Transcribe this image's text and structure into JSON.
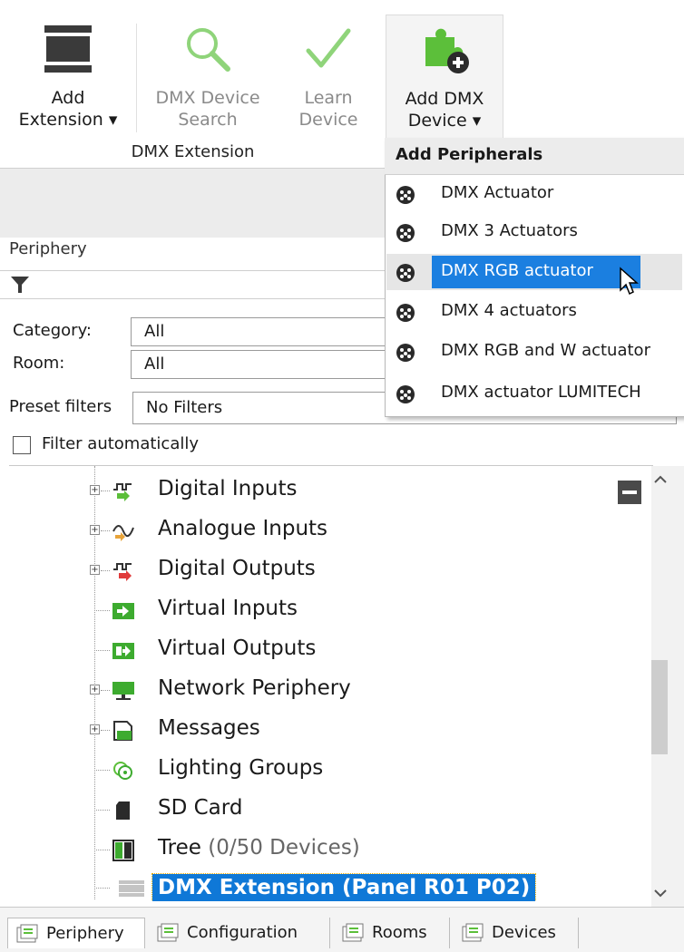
{
  "ribbon": {
    "buttons": [
      {
        "label_line1": "Add",
        "label_line2": "Extension ▾",
        "enabled": true
      },
      {
        "label_line1": "DMX Device",
        "label_line2": "Search",
        "enabled": false
      },
      {
        "label_line1": "Learn",
        "label_line2": "Device",
        "enabled": false
      },
      {
        "label_line1": "Add DMX",
        "label_line2": "Device ▾",
        "enabled": true
      }
    ],
    "group_label": "DMX Extension"
  },
  "panel": {
    "title": "Periphery"
  },
  "filters": {
    "category_label": "Category:",
    "category_value": "All",
    "room_label": "Room:",
    "room_value": "All",
    "preset_label": "Preset filters",
    "preset_value": "No Filters",
    "auto_label": "Filter automatically",
    "auto_checked": false
  },
  "tree": {
    "items": [
      {
        "label": "Digital Inputs",
        "icon": "digital-inputs-icon",
        "expandable": true
      },
      {
        "label": "Analogue Inputs",
        "icon": "analogue-inputs-icon",
        "expandable": true
      },
      {
        "label": "Digital Outputs",
        "icon": "digital-outputs-icon",
        "expandable": true
      },
      {
        "label": "Virtual Inputs",
        "icon": "virtual-inputs-icon",
        "expandable": false
      },
      {
        "label": "Virtual Outputs",
        "icon": "virtual-outputs-icon",
        "expandable": false
      },
      {
        "label": "Network Periphery",
        "icon": "network-icon",
        "expandable": true
      },
      {
        "label": "Messages",
        "icon": "messages-icon",
        "expandable": true
      },
      {
        "label": "Lighting Groups",
        "icon": "lighting-groups-icon",
        "expandable": false
      },
      {
        "label": "SD Card",
        "icon": "sd-card-icon",
        "expandable": false
      },
      {
        "label": "Tree",
        "extra": "(0/50 Devices)",
        "icon": "tree-icon",
        "expandable": false
      },
      {
        "label": "DMX Extension (Panel R01 P02)",
        "icon": "dmx-extension-icon",
        "expandable": false,
        "selected": true
      }
    ]
  },
  "dropdown": {
    "title": "Add Peripherals",
    "items": [
      "DMX Actuator",
      "DMX 3 Actuators",
      "DMX RGB actuator",
      "DMX 4 actuators",
      "DMX RGB and W actuator",
      "DMX actuator LUMITECH"
    ],
    "highlighted_index": 2
  },
  "tabs": [
    "Periphery",
    "Configuration",
    "Rooms",
    "Devices"
  ],
  "colors": {
    "selection": "#0f78d7",
    "menu_highlight": "#1b7fe0",
    "check_green": "#5cbf3a"
  }
}
